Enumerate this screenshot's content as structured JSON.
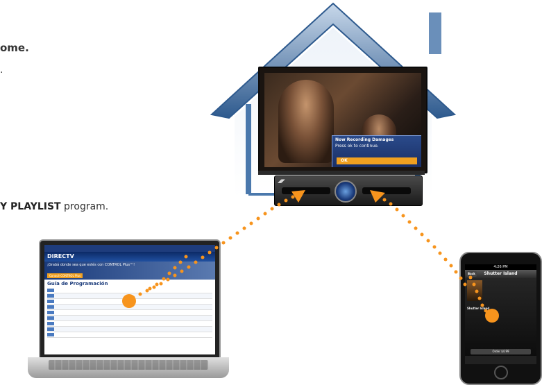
{
  "copy": {
    "line1": "ome.",
    "line2": ".",
    "line3_prefix": "Y PLAYLIST",
    "line3_suffix": " program."
  },
  "tv": {
    "dialog_title": "Now Recording Damages",
    "dialog_message": "Press ok to continue.",
    "dialog_ok": "OK"
  },
  "laptop": {
    "brand": "DIRECTV",
    "banner_text": "¡Grabá donde sea que estés con CONTROL Plus™!",
    "banner_button": "Conocé CONTROL Plus",
    "guide_title": "Guía de Programación"
  },
  "phone": {
    "status_time": "4:26 PM",
    "nav_back": "Back",
    "nav_title": "Shutter Island",
    "movie_title": "Shutter Island",
    "record_button": "Order $4.99"
  },
  "colors": {
    "accent": "#f7941d",
    "house": "#3a6aa0"
  }
}
